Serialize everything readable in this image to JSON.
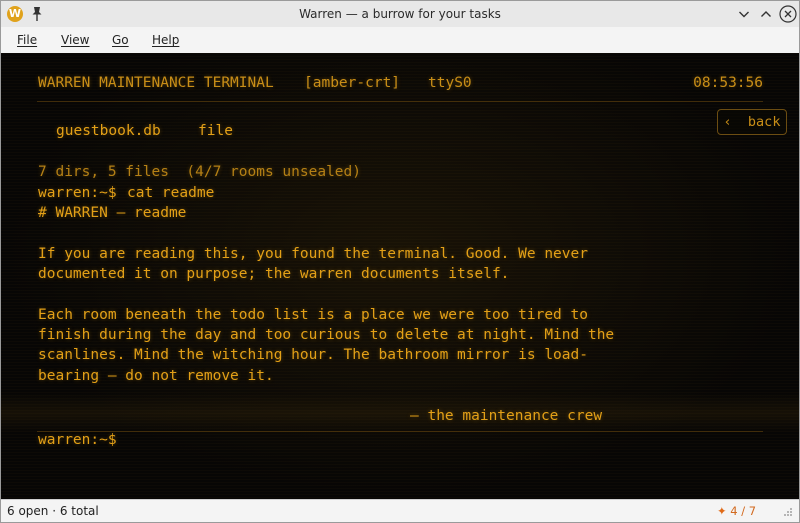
{
  "window": {
    "title": "Warren — a burrow for your tasks",
    "app_icon_letter": "W"
  },
  "menu": {
    "file": "File",
    "view": "View",
    "go": "Go",
    "help": "Help"
  },
  "terminal": {
    "header": {
      "title": "WARREN MAINTENANCE TERMINAL",
      "theme": "[amber-crt]",
      "tty": "ttyS0",
      "clock": "08:53:56"
    },
    "back_button": "‹  back",
    "listing": {
      "name": "guestbook.db",
      "kind": "file"
    },
    "summary": "7 dirs, 5 files  (4/7 rooms unsealed)",
    "prompt": "warren:~$",
    "command": "cat readme",
    "readme": {
      "heading": "# WARREN — readme",
      "para1": [
        "If you are reading this, you found the terminal. Good. We never",
        "documented it on purpose; the warren documents itself."
      ],
      "para2": [
        "Each room beneath the todo list is a place we were too tired to",
        "finish during the day and too curious to delete at night. Mind the",
        "scanlines. Mind the witching hour. The bathroom mirror is load-",
        "bearing — do not remove it."
      ],
      "signature": "— the maintenance crew"
    },
    "colors": {
      "amber": "#e3a017",
      "background": "#070605"
    }
  },
  "status": {
    "open": "6 open",
    "separator": " · ",
    "total": "6 total",
    "rooms_icon": "spark-icon",
    "rooms": "4 / 7"
  }
}
